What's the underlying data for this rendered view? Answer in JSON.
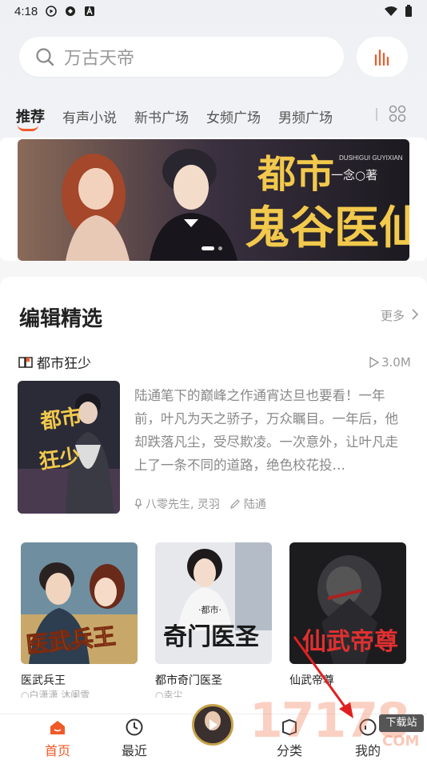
{
  "status": {
    "time": "4:18"
  },
  "search": {
    "placeholder": "万古天帝"
  },
  "tabs": [
    "推荐",
    "有声小说",
    "新书广场",
    "女频广场",
    "男频广场"
  ],
  "banner": {
    "title_big": "都市",
    "title_main": "鬼谷医仙",
    "pinyin": "DUSHIGUI GUYIXIAN",
    "author": "一念○著"
  },
  "section": {
    "title": "编辑精选",
    "more": "更多"
  },
  "featured": {
    "title": "都市狂少",
    "plays": "3.0M",
    "description": "陆通笔下的巅峰之作通宵达旦也要看！一年前，叶凡为天之骄子，万众瞩目。一年后，他却跌落凡尘，受尽欺凌。一次意外，让叶凡走上了一条不同的道路，绝色校花投…",
    "narrators": "八零先生, 灵羽",
    "author": "陆通",
    "cover_text": "都市狂少"
  },
  "books": [
    {
      "title": "医武兵王",
      "sub": "○白潇潇 沐阑雪",
      "cover_text": "医武兵王"
    },
    {
      "title": "都市奇门医圣",
      "sub": "○幸尘",
      "cover_text": "奇门医圣"
    },
    {
      "title": "仙武帝尊",
      "sub": "",
      "cover_text": "仙武帝尊"
    }
  ],
  "nav": {
    "home": "首页",
    "recent": "最近",
    "category": "分类",
    "mine": "我的"
  },
  "watermark": {
    "digits": "17178",
    "tag": "下载站",
    "com": "COM"
  },
  "colors": {
    "accent": "#f05a28"
  }
}
